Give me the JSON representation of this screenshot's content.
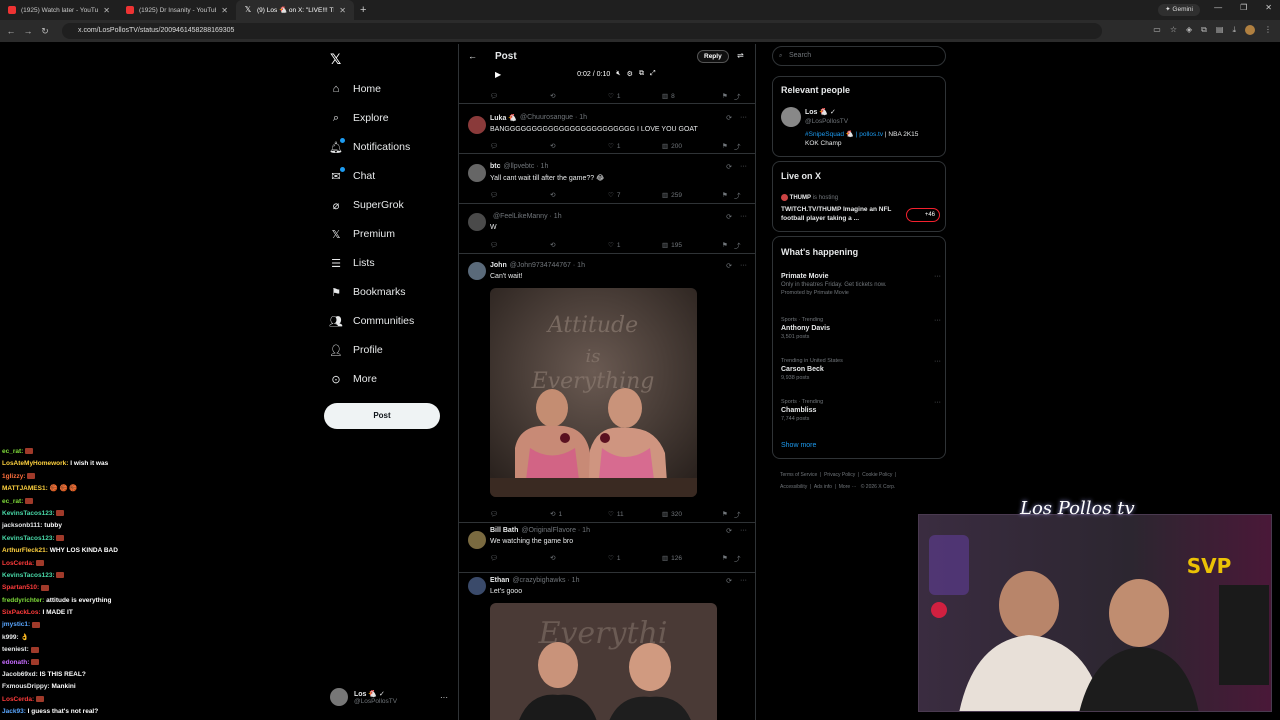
{
  "browser": {
    "tabs": [
      {
        "label": "(1925) Watch later - YouTube",
        "favicon": "youtube-icon"
      },
      {
        "label": "(1925) Dr Insanity - YouTube",
        "favicon": "youtube-icon"
      },
      {
        "label": "(9) Los 🐔 on X: \"LIVE!!! THUR:",
        "favicon": "x-icon",
        "active": true
      }
    ],
    "gemini_label": "Gemini",
    "url": "x.com/LosPollosTV/status/2009461458288169305"
  },
  "nav": {
    "items": [
      {
        "id": "home",
        "label": "Home",
        "icon": "home-icon"
      },
      {
        "id": "explore",
        "label": "Explore",
        "icon": "search-icon"
      },
      {
        "id": "notifications",
        "label": "Notifications",
        "icon": "bell-icon",
        "dot": true
      },
      {
        "id": "chat",
        "label": "Chat",
        "icon": "mail-icon",
        "dot": true
      },
      {
        "id": "supergrok",
        "label": "SuperGrok",
        "icon": "grok-icon"
      },
      {
        "id": "premium",
        "label": "Premium",
        "icon": "x-icon"
      },
      {
        "id": "lists",
        "label": "Lists",
        "icon": "list-icon"
      },
      {
        "id": "bookmarks",
        "label": "Bookmarks",
        "icon": "bookmark-icon"
      },
      {
        "id": "communities",
        "label": "Communities",
        "icon": "people-icon"
      },
      {
        "id": "profile",
        "label": "Profile",
        "icon": "person-icon"
      },
      {
        "id": "more",
        "label": "More",
        "icon": "more-circle-icon"
      }
    ],
    "post_label": "Post",
    "account": {
      "name": "Los 🐔 ✓",
      "handle": "@LosPollosTV"
    }
  },
  "main": {
    "title": "Post",
    "reply_label": "Reply",
    "video": {
      "time": "0:02 / 0:10"
    },
    "top_actions": {
      "likes": "1",
      "views": "8"
    },
    "tweets": [
      {
        "name": "Luka 🐔",
        "handle": "@Chuurosangue · 1h",
        "text": "BANGGGGGGGGGGGGGGGGGGGGGGGG I LOVE YOU GOAT",
        "likes": "1",
        "views": "200",
        "retweets": ""
      },
      {
        "name": "btc",
        "handle": "@llpvebtc · 1h",
        "text": "Yall cant wait till after the game?? 😂",
        "likes": "7",
        "views": "259",
        "retweets": ""
      },
      {
        "name": "",
        "handle": "@FeelLikeManny · 1h",
        "text": "W",
        "likes": "1",
        "views": "195",
        "retweets": ""
      },
      {
        "name": "John",
        "handle": "@John9734744767 · 1h",
        "text": "Can't wait!",
        "likes": "11",
        "views": "320",
        "retweets": "1"
      },
      {
        "name": "Bill Bath",
        "handle": "@OriginalFlavore · 1h",
        "text": "We watching the game bro",
        "likes": "1",
        "views": "126",
        "retweets": ""
      },
      {
        "name": "Ethan",
        "handle": "@crazybighawks · 1h",
        "text": "Let's gooo",
        "likes": "",
        "views": "",
        "retweets": ""
      }
    ],
    "image_text_1": "Attitude is Everything",
    "image_text_2": "Everythi"
  },
  "right": {
    "search_placeholder": "Search",
    "relevant": {
      "title": "Relevant people",
      "name": "Los 🐔 ✓",
      "handle": "@LosPollosTV",
      "bio_tag": "#SnipeSquad 🐔 |",
      "bio_link": "pollos.tv",
      "bio_rest": "| NBA 2K15",
      "bio_line2": "KOK Champ"
    },
    "live": {
      "title": "Live on X",
      "host": "THUMP",
      "host_suffix": "is hosting",
      "text": "TWITCH.TV/THUMP Imagine an NFL football player taking a ...",
      "count": "+46"
    },
    "happening": {
      "title": "What's happening",
      "items": [
        {
          "category": "",
          "title": "Primate Movie",
          "sub": "Only in theatres Friday. Get tickets now.",
          "count": "Promoted by Primate Movie"
        },
        {
          "category": "Sports · Trending",
          "title": "Anthony Davis",
          "sub": "",
          "count": "3,501 posts"
        },
        {
          "category": "Trending in United States",
          "title": "Carson Beck",
          "sub": "",
          "count": "9,938 posts"
        },
        {
          "category": "Sports · Trending",
          "title": "Chambliss",
          "sub": "",
          "count": "7,744 posts"
        }
      ],
      "show_more": "Show more"
    },
    "footer": [
      "Terms of Service",
      "Privacy Policy",
      "Cookie Policy",
      "Accessibility",
      "Ads info",
      "More ···",
      "© 2026 X Corp."
    ]
  },
  "chat": [
    {
      "user": "ec_rat:",
      "color": "#7fdc3a",
      "msg": "",
      "brick": true
    },
    {
      "user": "LosAteMyHomework:",
      "color": "#ffd23f",
      "msg": "I wish it was",
      "brick": false
    },
    {
      "user": "1glizzy:",
      "color": "#ff6f3c",
      "msg": "",
      "brick": true
    },
    {
      "user": "MATTJAMES1:",
      "color": "#ffd23f",
      "msg": "🏀 🏀 🏀",
      "brick": false
    },
    {
      "user": "ec_rat:",
      "color": "#7fdc3a",
      "msg": "",
      "brick": true
    },
    {
      "user": "KevinsTacos123:",
      "color": "#49d9a8",
      "msg": "",
      "brick": true
    },
    {
      "user": "jacksonb111:",
      "color": "#e7e9ea",
      "msg": "tubby",
      "brick": false
    },
    {
      "user": "KevinsTacos123:",
      "color": "#49d9a8",
      "msg": "",
      "brick": true
    },
    {
      "user": "ArthurFleck21:",
      "color": "#ffd23f",
      "msg": "WHY LOS KINDA BAD",
      "brick": false
    },
    {
      "user": "LosCerda:",
      "color": "#ff3b3b",
      "msg": "",
      "brick": true
    },
    {
      "user": "KevinsTacos123:",
      "color": "#49d9a8",
      "msg": "",
      "brick": true
    },
    {
      "user": "Spartan510:",
      "color": "#ff3b3b",
      "msg": "",
      "brick": true
    },
    {
      "user": "freddyrichter:",
      "color": "#7fdc3a",
      "msg": "attitude is everything",
      "brick": false
    },
    {
      "user": "SixPackLos:",
      "color": "#ff3b3b",
      "msg": "I MADE IT",
      "brick": false
    },
    {
      "user": "jmystic1:",
      "color": "#5aa7ff",
      "msg": "",
      "brick": true
    },
    {
      "user": "k999:",
      "color": "#e7e9ea",
      "msg": "👌",
      "brick": false
    },
    {
      "user": "teeniest:",
      "color": "#e7e9ea",
      "msg": "",
      "brick": true
    },
    {
      "user": "edonath:",
      "color": "#c66bff",
      "msg": "",
      "brick": true
    },
    {
      "user": "Jacob69xd:",
      "color": "#e7e9ea",
      "msg": "IS THIS REAL?",
      "brick": false
    },
    {
      "user": "FxmousDrippy:",
      "color": "#e7e9ea",
      "msg": "Mankini",
      "brick": false
    },
    {
      "user": "LosCerda:",
      "color": "#ff3b3b",
      "msg": "",
      "brick": true
    },
    {
      "user": "Jack93:",
      "color": "#5aa7ff",
      "msg": "I guess that's not real?",
      "brick": false
    }
  ],
  "stream_logo": "Los Pollos tv",
  "colors": {
    "accent": "#1d9bf0",
    "border": "#2f3336",
    "muted": "#71767b"
  }
}
